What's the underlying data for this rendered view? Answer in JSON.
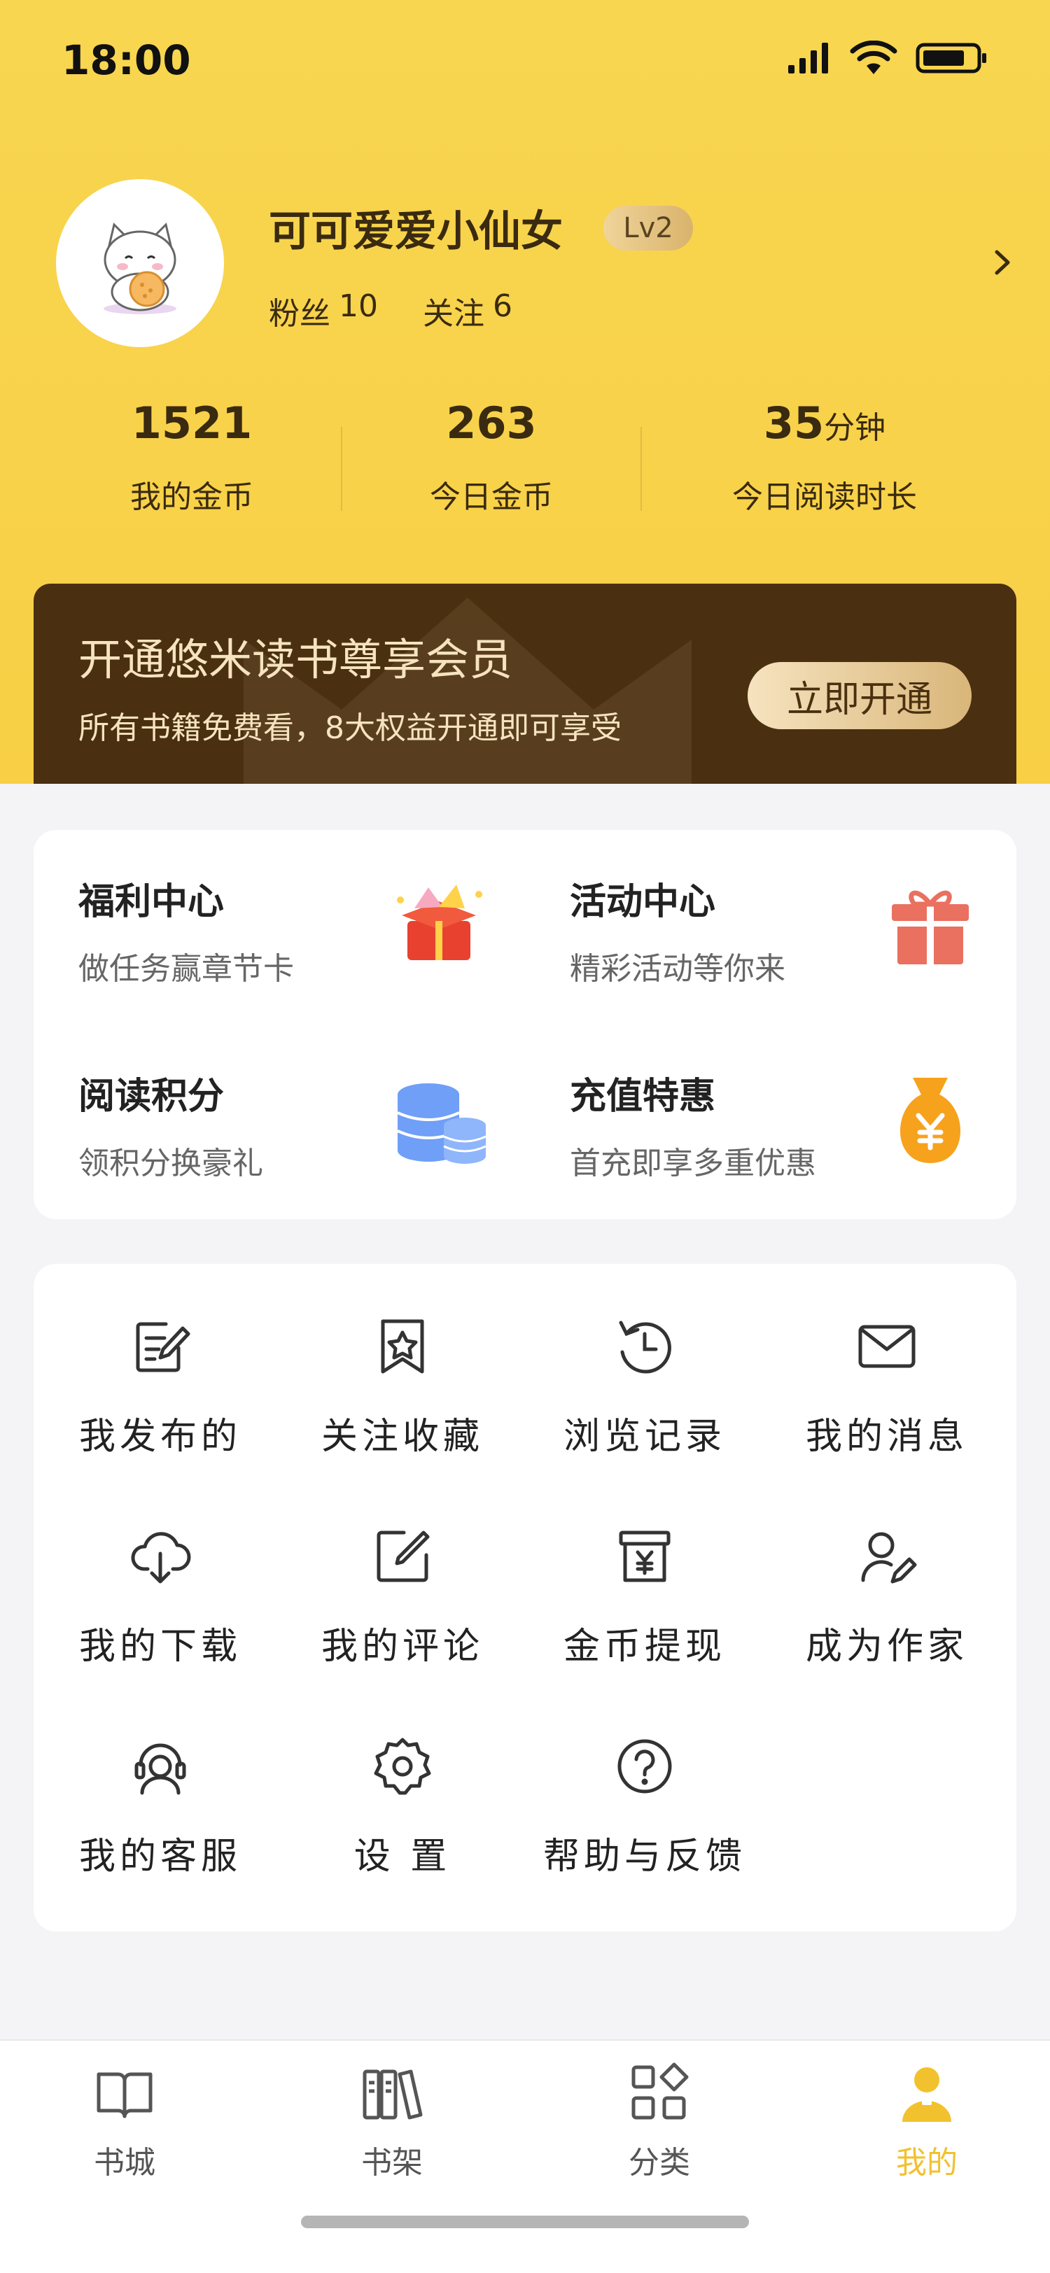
{
  "status_bar": {
    "time": "18:00"
  },
  "profile": {
    "username": "可可爱爱小仙女",
    "level": "Lv2",
    "fans_label": "粉丝",
    "fans_count": "10",
    "follow_label": "关注",
    "follow_count": "6"
  },
  "stats": [
    {
      "value": "1521",
      "unit": "",
      "label": "我的金币"
    },
    {
      "value": "263",
      "unit": "",
      "label": "今日金币"
    },
    {
      "value": "35",
      "unit": "分钟",
      "label": "今日阅读时长"
    }
  ],
  "vip": {
    "title": "开通悠米读书尊享会员",
    "subtitle": "所有书籍免费看，8大权益开通即可享受",
    "button": "立即开通"
  },
  "benefits": [
    {
      "title": "福利中心",
      "subtitle": "做任务赢章节卡",
      "icon": "gift-box-icon"
    },
    {
      "title": "活动中心",
      "subtitle": "精彩活动等你来",
      "icon": "present-icon"
    },
    {
      "title": "阅读积分",
      "subtitle": "领积分换豪礼",
      "icon": "coins-icon"
    },
    {
      "title": "充值特惠",
      "subtitle": "首充即享多重优惠",
      "icon": "money-bag-icon"
    }
  ],
  "menu": [
    {
      "label": "我发布的",
      "icon": "edit-doc-icon"
    },
    {
      "label": "关注收藏",
      "icon": "bookmark-star-icon"
    },
    {
      "label": "浏览记录",
      "icon": "history-icon"
    },
    {
      "label": "我的消息",
      "icon": "mail-icon"
    },
    {
      "label": "我的下载",
      "icon": "cloud-download-icon"
    },
    {
      "label": "我的评论",
      "icon": "comment-edit-icon"
    },
    {
      "label": "金币提现",
      "icon": "withdraw-icon"
    },
    {
      "label": "成为作家",
      "icon": "writer-icon"
    },
    {
      "label": "我的客服",
      "icon": "customer-service-icon"
    },
    {
      "label": "设 置",
      "icon": "settings-icon"
    },
    {
      "label": "帮助与反馈",
      "icon": "help-icon"
    }
  ],
  "tabbar": [
    {
      "label": "书城",
      "icon": "book-open-icon"
    },
    {
      "label": "书架",
      "icon": "bookshelf-icon"
    },
    {
      "label": "分类",
      "icon": "category-icon"
    },
    {
      "label": "我的",
      "icon": "profile-icon",
      "active": true
    }
  ],
  "colors": {
    "header": "#f8d650",
    "accent": "#f2c12e",
    "vip_bg": "#4a3010"
  }
}
